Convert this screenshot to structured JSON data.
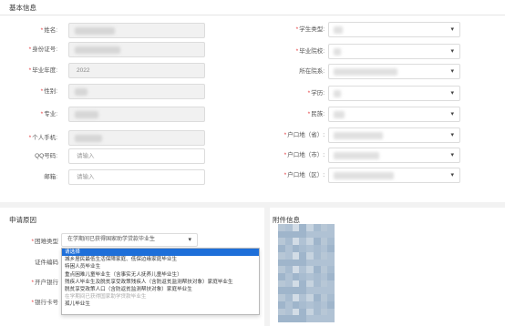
{
  "basic_info": {
    "title": "基本信息",
    "left_fields": [
      {
        "label": "姓名:",
        "required": true,
        "value": "",
        "type": "input-disabled",
        "masked": true
      },
      {
        "label": "身份证号:",
        "required": true,
        "value": "",
        "type": "input-disabled",
        "masked": true
      },
      {
        "label": "毕业年度:",
        "required": true,
        "value": "2022",
        "type": "input-disabled",
        "masked": false
      },
      {
        "label": "性别:",
        "required": true,
        "value": "",
        "type": "input-disabled",
        "masked": true
      },
      {
        "label": "专业:",
        "required": true,
        "value": "",
        "type": "input-disabled",
        "masked": true
      },
      {
        "label": "个人手机:",
        "required": true,
        "value": "",
        "type": "input-disabled",
        "masked": true
      },
      {
        "label": "QQ号码:",
        "required": false,
        "value": "",
        "placeholder": "请输入",
        "type": "input"
      },
      {
        "label": "邮箱:",
        "required": false,
        "value": "",
        "placeholder": "请输入",
        "type": "input"
      }
    ],
    "right_fields": [
      {
        "label": "学生类型:",
        "required": true,
        "type": "select",
        "masked": true
      },
      {
        "label": "毕业院校:",
        "required": true,
        "type": "select",
        "masked": true
      },
      {
        "label": "所在院系:",
        "required": false,
        "type": "select",
        "masked": true
      },
      {
        "label": "学历:",
        "required": true,
        "type": "select",
        "masked": true
      },
      {
        "label": "民族:",
        "required": true,
        "type": "select",
        "masked": true
      },
      {
        "label": "户口地（省）:",
        "required": true,
        "type": "select",
        "masked": true
      },
      {
        "label": "户口地（市）:",
        "required": true,
        "type": "select",
        "masked": true
      },
      {
        "label": "户口地（区）:",
        "required": true,
        "type": "select",
        "masked": true
      }
    ]
  },
  "application": {
    "title": "申请原因",
    "difficulty_type": {
      "label": "困难类型",
      "required": true,
      "value": "在学期间已获得国家助学贷款毕业生"
    },
    "id_number_label": "证件编码",
    "open_bank": {
      "label": "开户银行",
      "required": true
    },
    "bank_card": {
      "label": "银行卡号",
      "required": true
    },
    "dropdown_options": [
      {
        "text": "请选择",
        "state": "selected"
      },
      {
        "text": "城乡居民最低生活保障家庭、低保边缘家庭毕业生",
        "state": "normal"
      },
      {
        "text": "特困人员毕业生",
        "state": "normal"
      },
      {
        "text": "重点困难儿童毕业生（含事实无人抚养儿童毕业生）",
        "state": "normal"
      },
      {
        "text": "残疾人毕业生及脱贫享受政策残疾人（含防返贫监测帮扶对象）家庭毕业生",
        "state": "normal"
      },
      {
        "text": "脱贫享受政策人口（含防返贫监测帮扶对象）家庭毕业生",
        "state": "normal"
      },
      {
        "text": "在学期间已获得国家助学贷款毕业生",
        "state": "disabled"
      },
      {
        "text": "孤儿毕业生",
        "state": "normal"
      }
    ]
  },
  "attachments": {
    "title": "附件信息"
  },
  "colors": {
    "required": "#e4393c",
    "selected_option": "#1e6fd9",
    "mosaic": [
      "#b7c7d6",
      "#a8bcd0",
      "#c6d3df",
      "#9fb5cb",
      "#d2dce6",
      "#b0c2d4"
    ]
  }
}
